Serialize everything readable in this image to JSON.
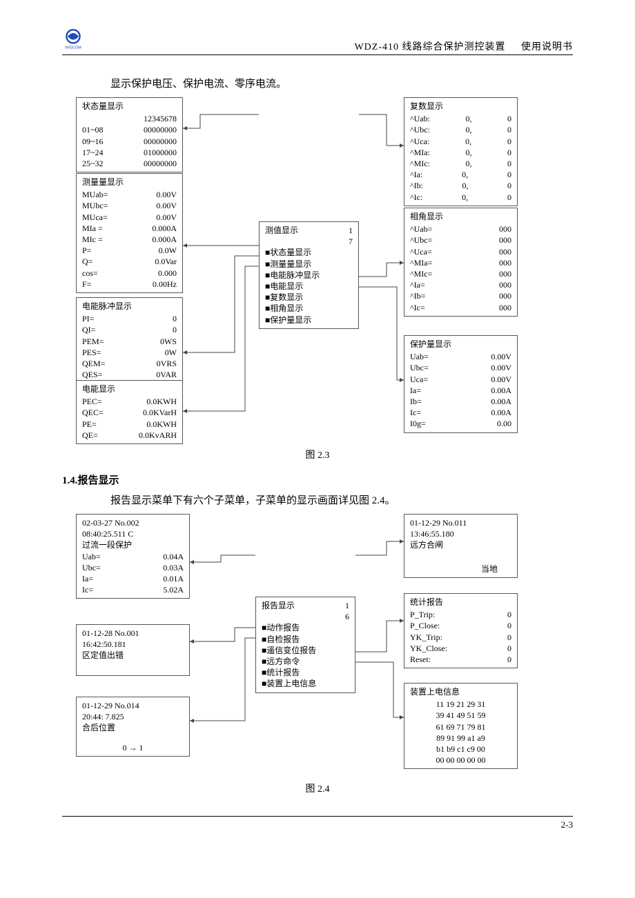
{
  "header": {
    "device": "WDZ-410 线路综合保护测控装置",
    "doc": "使用说明书"
  },
  "intro": "显示保护电压、保护电流、零序电流。",
  "fig23": {
    "caption": "图 2.3",
    "status": {
      "title": "状态量显示",
      "header": "12345678",
      "rows": [
        {
          "lbl": "01~08",
          "val": "00000000"
        },
        {
          "lbl": "09~16",
          "val": "00000000"
        },
        {
          "lbl": "17~24",
          "val": "01000000"
        },
        {
          "lbl": "25~32",
          "val": "00000000"
        }
      ]
    },
    "measure": {
      "title": "测量量显示",
      "rows": [
        {
          "lbl": "MUab=",
          "val": "0.00V"
        },
        {
          "lbl": "MUbc=",
          "val": "0.00V"
        },
        {
          "lbl": "MUca=",
          "val": "0.00V"
        },
        {
          "lbl": "MIa =",
          "val": "0.000A"
        },
        {
          "lbl": "MIc =",
          "val": "0.000A"
        },
        {
          "lbl": "P=",
          "val": "0.0W"
        },
        {
          "lbl": "Q=",
          "val": "0.0Var"
        },
        {
          "lbl": "cos=",
          "val": "0.000"
        },
        {
          "lbl": "F=",
          "val": "0.00Hz"
        }
      ]
    },
    "pulse": {
      "title": "电能脉冲显示",
      "rows": [
        {
          "lbl": "PI=",
          "val": "0"
        },
        {
          "lbl": "QI=",
          "val": "0"
        },
        {
          "lbl": "PEM=",
          "val": "0WS"
        },
        {
          "lbl": "PES=",
          "val": "0W"
        },
        {
          "lbl": "QEM=",
          "val": "0VRS"
        },
        {
          "lbl": "QES=",
          "val": "0VAR"
        }
      ]
    },
    "energy": {
      "title": "电能显示",
      "rows": [
        {
          "lbl": "PEC=",
          "val": "0.0KWH"
        },
        {
          "lbl": "QEC=",
          "val": "0.0KVarH"
        },
        {
          "lbl": "PE=",
          "val": "0.0KWH"
        },
        {
          "lbl": "QE=",
          "val": "0.0KvARH"
        }
      ]
    },
    "menu": {
      "title": "测值显示",
      "num1": "1",
      "num2": "7",
      "items": [
        "■状态量显示",
        "■测量量显示",
        "■电能脉冲显示",
        "■电能显示",
        "■复数显示",
        "■相角显示",
        "■保护量显示"
      ]
    },
    "complex": {
      "title": "复数显示",
      "rows": [
        {
          "lbl": "^Uab:",
          "v1": "0,",
          "v2": "0"
        },
        {
          "lbl": "^Ubc:",
          "v1": "0,",
          "v2": "0"
        },
        {
          "lbl": "^Uca:",
          "v1": "0,",
          "v2": "0"
        },
        {
          "lbl": "^MIa:",
          "v1": "0,",
          "v2": "0"
        },
        {
          "lbl": "^MIc:",
          "v1": "0,",
          "v2": "0"
        },
        {
          "lbl": "^Ia:",
          "v1": "0,",
          "v2": "0"
        },
        {
          "lbl": "^Ib:",
          "v1": "0,",
          "v2": "0"
        },
        {
          "lbl": "^Ic:",
          "v1": "0,",
          "v2": "0"
        }
      ]
    },
    "phase": {
      "title": "相角显示",
      "rows": [
        {
          "lbl": "^Uab=",
          "val": "000"
        },
        {
          "lbl": "^Ubc=",
          "val": "000"
        },
        {
          "lbl": "^Uca=",
          "val": "000"
        },
        {
          "lbl": "^MIa=",
          "val": "000"
        },
        {
          "lbl": "^MIc=",
          "val": "000"
        },
        {
          "lbl": "^Ia=",
          "val": "000"
        },
        {
          "lbl": "^Ib=",
          "val": "000"
        },
        {
          "lbl": "^Ic=",
          "val": "000"
        }
      ]
    },
    "protect": {
      "title": "保护量显示",
      "rows": [
        {
          "lbl": "Uab=",
          "val": "0.00V"
        },
        {
          "lbl": "Ubc=",
          "val": "0.00V"
        },
        {
          "lbl": "Uca=",
          "val": "0.00V"
        },
        {
          "lbl": "Ia=",
          "val": "0.00A"
        },
        {
          "lbl": "Ib=",
          "val": "0.00A"
        },
        {
          "lbl": "Ic=",
          "val": "0.00A"
        },
        {
          "lbl": "I0g=",
          "val": "0.00"
        }
      ]
    }
  },
  "section14": {
    "title": "1.4.报告显示",
    "desc": "报告显示菜单下有六个子菜单，子菜单的显示画面详见图 2.4。"
  },
  "fig24": {
    "caption": "图 2.4",
    "action": {
      "l1": "02-03-27   No.002",
      "l2": "08:40:25.511   C",
      "l3": "过流一段保护",
      "rows": [
        {
          "lbl": "Uab=",
          "val": "0.04A"
        },
        {
          "lbl": "Ubc=",
          "val": "0.03A"
        },
        {
          "lbl": "Ia=",
          "val": "0.01A"
        },
        {
          "lbl": "Ic=",
          "val": "5.02A"
        }
      ]
    },
    "selfcheck": {
      "l1": "01-12-28   No.001",
      "l2": "16:42:50.181",
      "l3": "区定值出错"
    },
    "yx": {
      "l1": "01-12-29   No.014",
      "l2": "20:44: 7.825",
      "l3": "合后位置",
      "l4": "0 → 1"
    },
    "menu": {
      "title": "报告显示",
      "num1": "1",
      "num2": "6",
      "items": [
        "■动作报告",
        "■自检报告",
        "■遥信变位报告",
        "■远方命令",
        "■统计报告",
        "■装置上电信息"
      ]
    },
    "remote": {
      "l1": "01-12-29   No.011",
      "l2": "13:46:55.180",
      "l3": "远方合闸",
      "l4": "当地"
    },
    "stats": {
      "title": "统计报告",
      "rows": [
        {
          "lbl": "P_Trip:",
          "val": "0"
        },
        {
          "lbl": "P_Close:",
          "val": "0"
        },
        {
          "lbl": "YK_Trip:",
          "val": "0"
        },
        {
          "lbl": "YK_Close:",
          "val": "0"
        },
        {
          "lbl": "Reset:",
          "val": "0"
        }
      ]
    },
    "power": {
      "title": "装置上电信息",
      "lines": [
        "11 19 21 29 31",
        "39 41 49 51 59",
        "61 69 71 79 81",
        "89 91 99 a1 a9",
        "b1 b9 c1 c9 00",
        "00 00 00 00 00"
      ]
    }
  },
  "footer": "2-3"
}
